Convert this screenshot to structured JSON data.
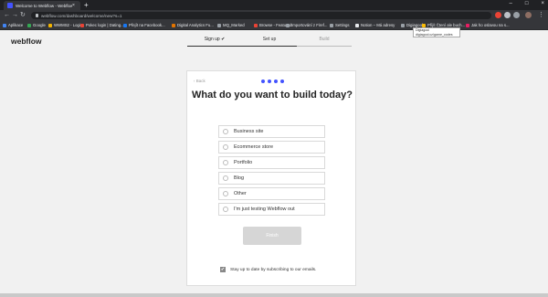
{
  "browser": {
    "tab_title": "Welcome to Webflow - Webflow",
    "tab_close": "×",
    "new_tab": "+",
    "url": "webflow.com/dashboard/welcome/new?s=1",
    "tooltip": [
      "Digiagool",
      "digiagool.cz/game_codes"
    ]
  },
  "bookmarks": [
    {
      "label": "Aplikace",
      "color": "#4285f4"
    },
    {
      "label": "Google",
      "color": "#34a853"
    },
    {
      "label": "WWMS2 - Login",
      "color": "#f4b400"
    },
    {
      "label": "Pokec login | Dating...",
      "color": "#ea4335"
    },
    {
      "label": "Přejít na Facebook...",
      "color": "#1877f2"
    },
    {
      "label": "Digital Analytics Fu...",
      "color": "#e37400"
    },
    {
      "label": "MQ_Marked",
      "color": "#9aa0a6"
    },
    {
      "label": "Browse - Featured",
      "color": "#ea4335"
    },
    {
      "label": "Importování z Firef...",
      "color": "#9aa0a6"
    },
    {
      "label": "Settings",
      "color": "#9aa0a6"
    },
    {
      "label": "Notion – Má adresy",
      "color": "#e8eaed"
    },
    {
      "label": "Digiagool...",
      "color": "#9aa0a6"
    },
    {
      "label": "Přijít Čtení ale buch...",
      "color": "#fbbc04"
    },
    {
      "label": "Jak ho oslavou na s...",
      "color": "#e91e63"
    }
  ],
  "page": {
    "logo": "webflow",
    "steps": [
      {
        "label": "Sign up ✔"
      },
      {
        "label": "Set up"
      },
      {
        "label": "Build"
      }
    ],
    "card": {
      "back": "‹ Back",
      "heading": "What do you want to build today?",
      "options": [
        "Business site",
        "Ecommerce store",
        "Portfolio",
        "Blog",
        "Other",
        "I'm just testing Webflow out"
      ],
      "next": "Finish"
    },
    "subscribe": {
      "label": "Stay up to date by subscribing to our emails.",
      "checked": true,
      "check_glyph": "✔"
    }
  }
}
